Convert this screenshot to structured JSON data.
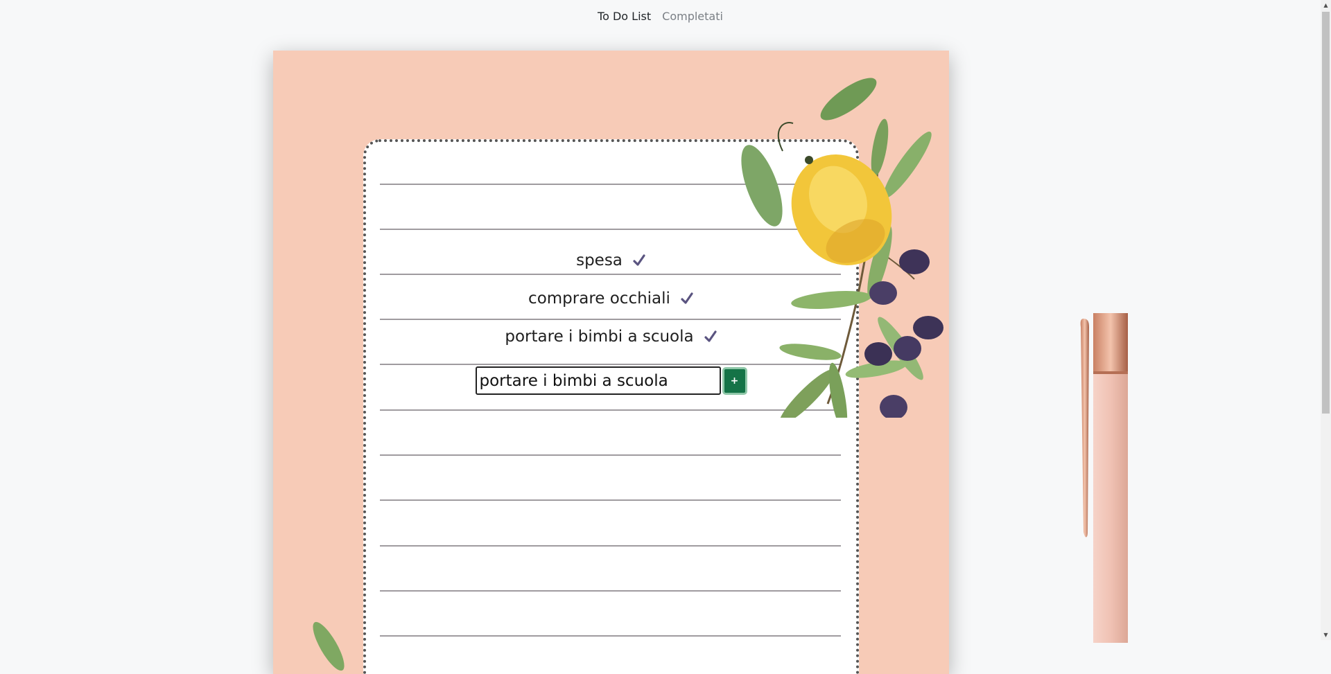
{
  "nav": {
    "items": [
      {
        "label": "To Do List",
        "active": true
      },
      {
        "label": "Completati",
        "active": false
      }
    ]
  },
  "tasks": [
    {
      "text": "spesa",
      "icon": "check-icon"
    },
    {
      "text": "comprare occhiali",
      "icon": "check-icon"
    },
    {
      "text": "portare i bimbi a scuola",
      "icon": "check-icon"
    }
  ],
  "new_task": {
    "value": "portare i bimbi a scuola",
    "button_label": "+"
  },
  "colors": {
    "paper": "#f7cbb7",
    "button": "#157347",
    "check": "#5a5480",
    "pen": "#f2c9bd"
  },
  "decorations": [
    "lemon-olive-branch-illustration",
    "rose-gold-pen-illustration",
    "leaf-illustration"
  ]
}
